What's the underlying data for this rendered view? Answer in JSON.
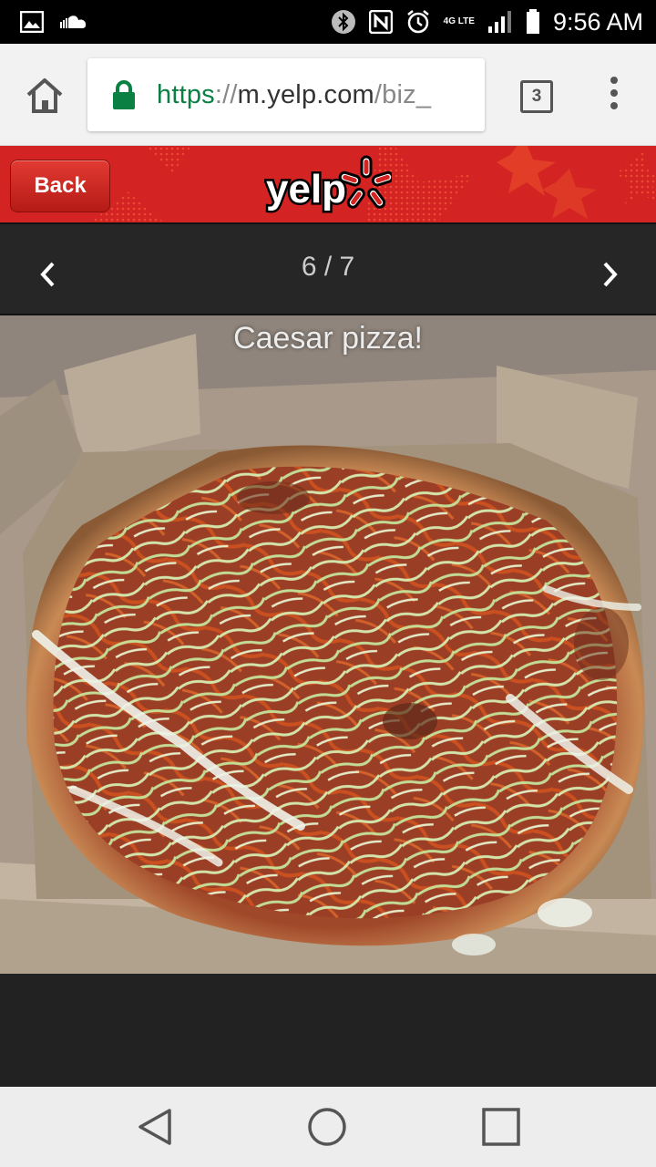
{
  "status_bar": {
    "time": "9:56 AM",
    "network_label": "4G LTE",
    "icons": [
      "gallery-icon",
      "soundcloud-icon",
      "bluetooth-icon",
      "nfc-icon",
      "alarm-icon",
      "signal-icon",
      "battery-icon"
    ]
  },
  "browser": {
    "url_scheme": "https",
    "url_separator": "://",
    "url_host": "m.yelp.com",
    "url_path": "/biz_",
    "tab_count": "3"
  },
  "header": {
    "back_label": "Back",
    "logo_text": "yelp",
    "brand_color": "#d32323"
  },
  "gallery": {
    "counter": "6 / 7",
    "caption": "Caesar pizza!"
  },
  "nav": {
    "buttons": [
      "back",
      "home",
      "recents"
    ]
  }
}
